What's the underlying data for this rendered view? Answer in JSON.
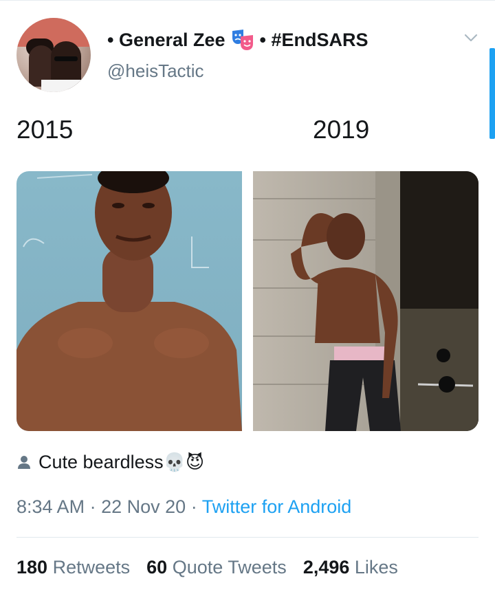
{
  "tweet": {
    "author": {
      "display_name": "• General Zee",
      "display_suffix": "• #EndSARS",
      "handle": "@heisTactic",
      "avatar_icon": "profile-photo"
    },
    "left_label": "2015",
    "right_label": "2019",
    "caption_text": "Cute beardless",
    "caption_emojis": [
      "💀",
      "😈"
    ],
    "time": "8:34 AM",
    "date": "22 Nov 20",
    "source": "Twitter for Android",
    "stats": {
      "retweets_count": "180",
      "retweets_label": "Retweets",
      "quotes_count": "60",
      "quotes_label": "Quote Tweets",
      "likes_count": "2,496",
      "likes_label": "Likes"
    }
  },
  "colors": {
    "accent": "#1da1f2",
    "text_primary": "#14171a",
    "text_secondary": "#657786",
    "divider": "#e1e8ed"
  }
}
